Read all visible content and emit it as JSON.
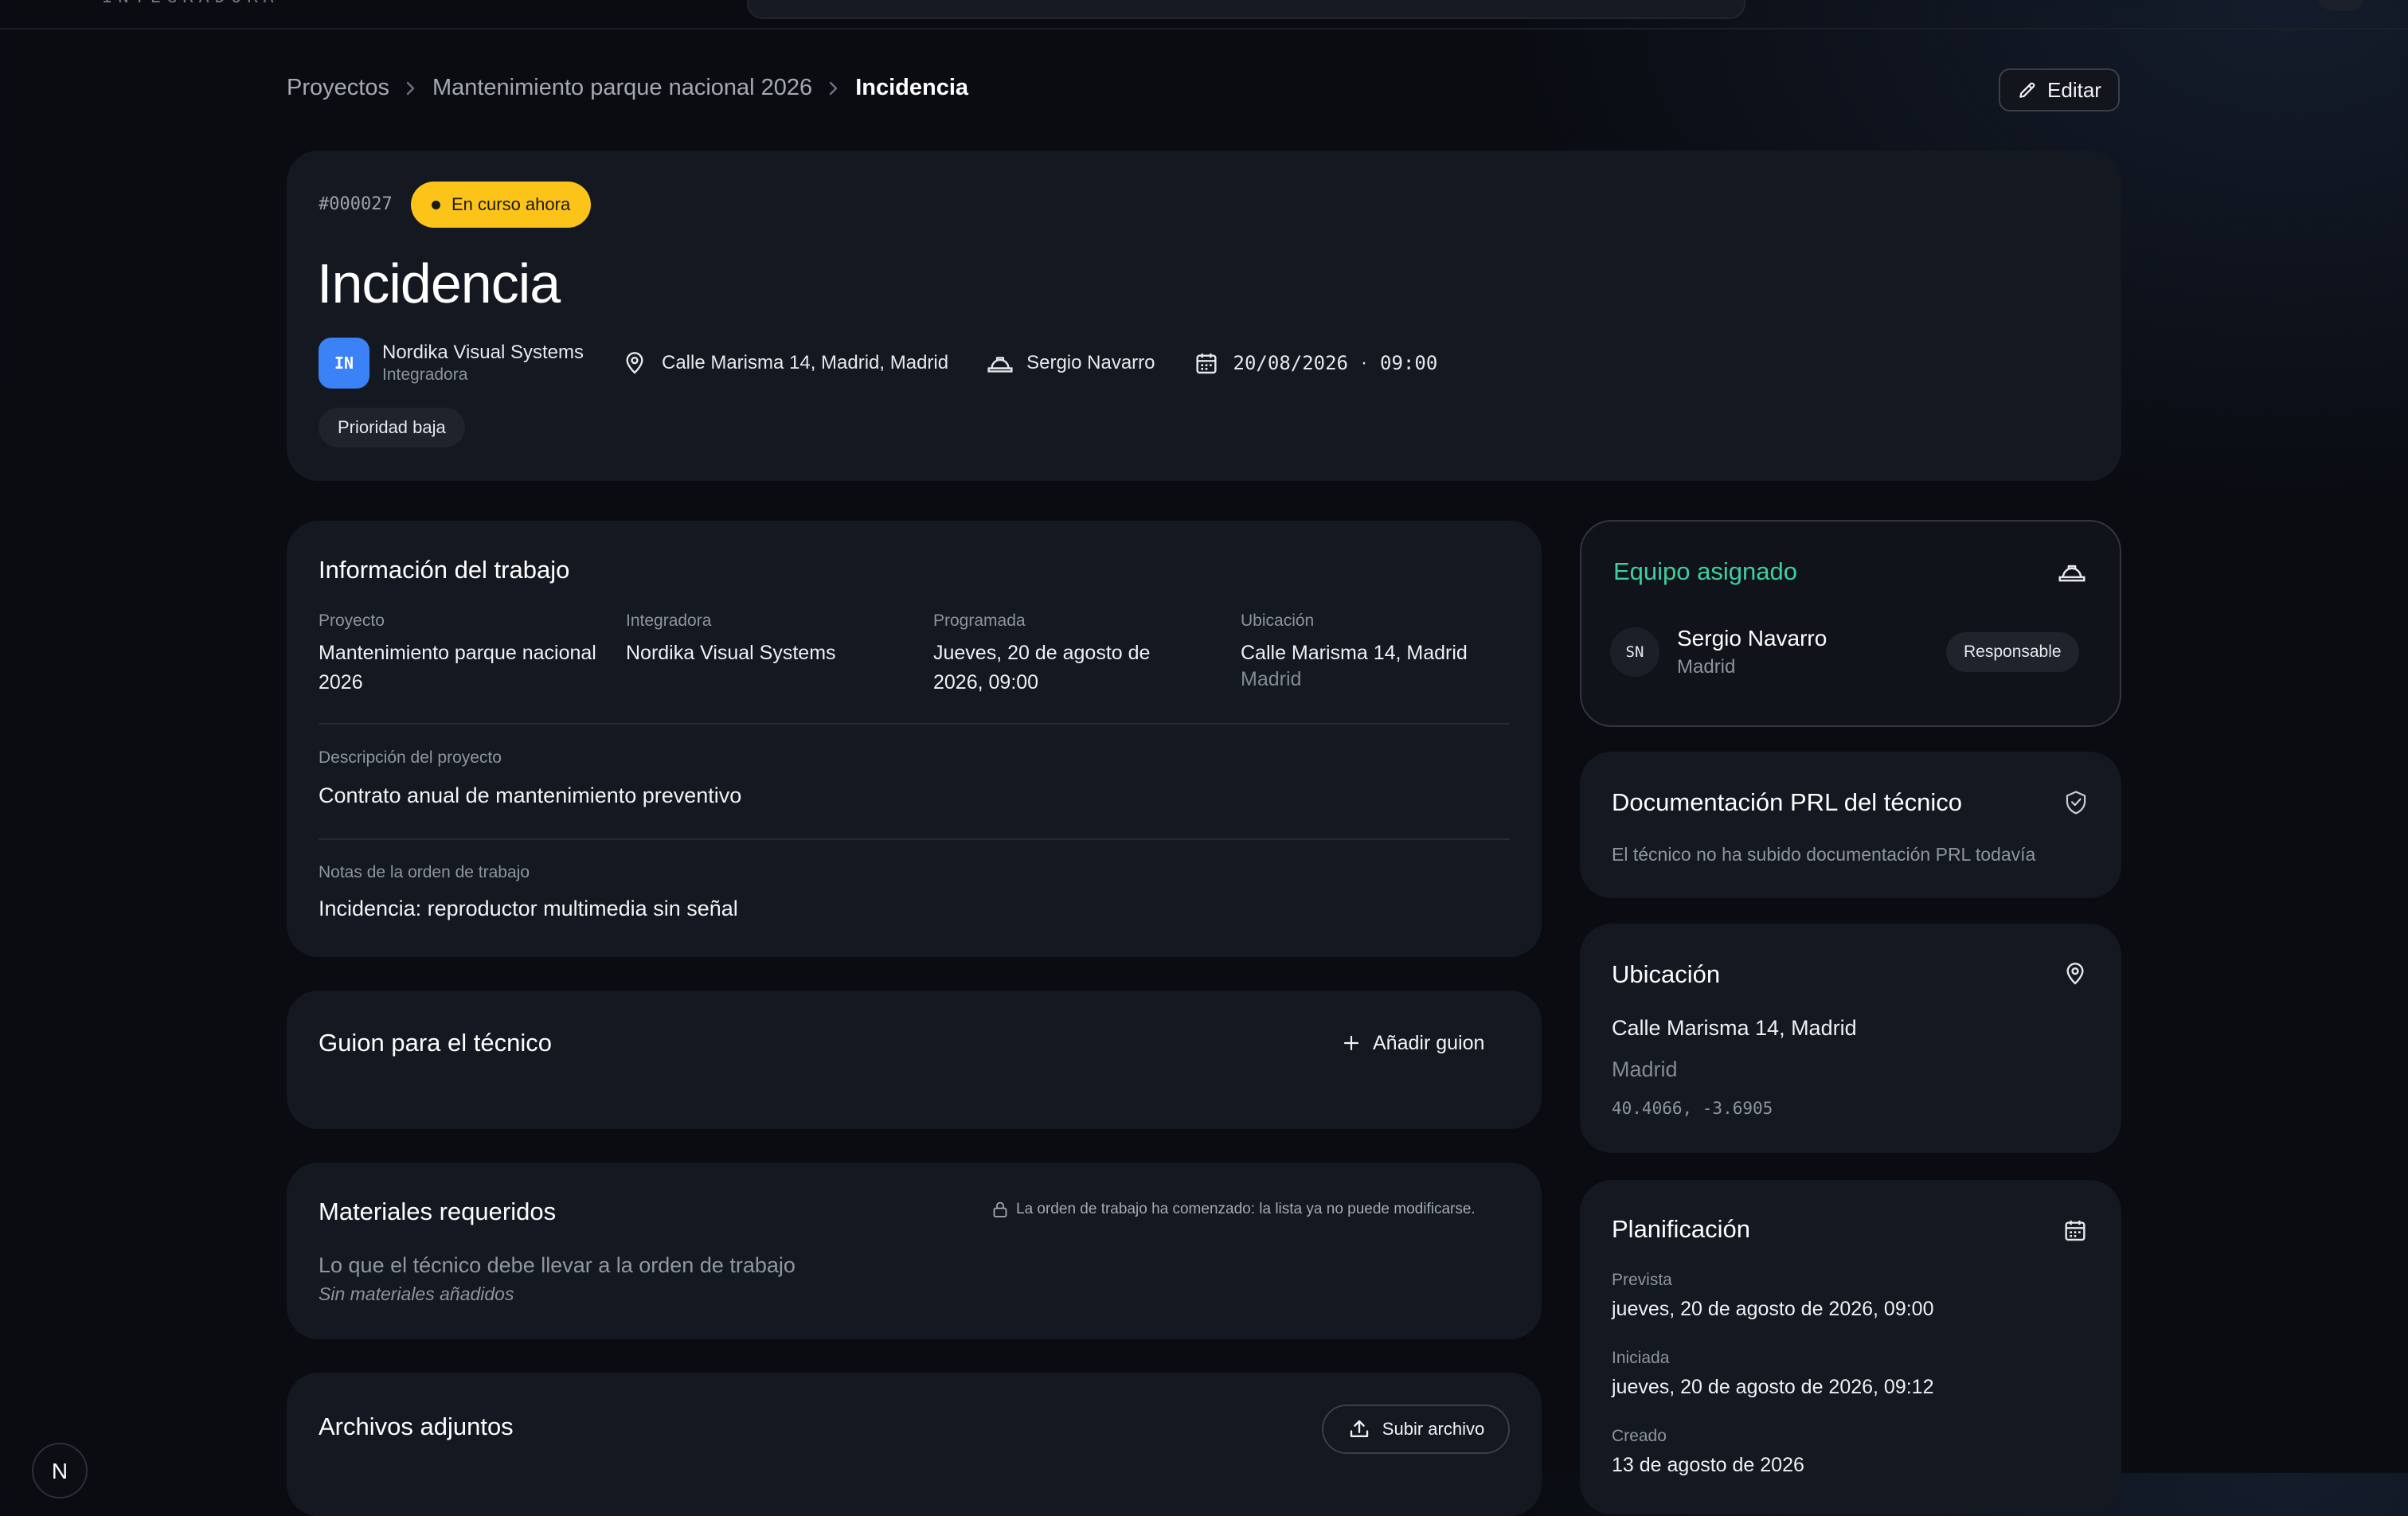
{
  "topbar": {
    "logo_text": "INTEGRADORA"
  },
  "breadcrumb": {
    "items": [
      "Proyectos",
      "Mantenimiento parque nacional 2026",
      "Incidencia"
    ],
    "separator": "›"
  },
  "header": {
    "edit_label": "Editar",
    "id": "#000027",
    "status": "En curso ahora",
    "title": "Incidencia",
    "company_initials": "IN",
    "company_name": "Nordika Visual Systems",
    "company_role": "Integradora",
    "address": "Calle Marisma 14, Madrid, Madrid",
    "technician": "Sergio Navarro",
    "date": "20/08/2026",
    "dot": "·",
    "time": "09:00",
    "priority": "Prioridad baja"
  },
  "info": {
    "title": "Información del trabajo",
    "fields": [
      {
        "label": "Proyecto",
        "value": "Mantenimiento parque nacional 2026"
      },
      {
        "label": "Integradora",
        "value": "Nordika Visual Systems"
      },
      {
        "label": "Programada",
        "value": "Jueves, 20 de agosto de 2026, 09:00"
      },
      {
        "label": "Ubicación",
        "value": "Calle Marisma 14, Madrid",
        "sub": "Madrid"
      }
    ],
    "description_label": "Descripción del proyecto",
    "description": "Contrato anual de mantenimiento preventivo",
    "notes_label": "Notas de la orden de trabajo",
    "notes": "Incidencia: reproductor multimedia sin señal"
  },
  "script": {
    "title": "Guion para el técnico",
    "add_label": "Añadir guion"
  },
  "materials": {
    "title": "Materiales requeridos",
    "locked_note": "La orden de trabajo ha comenzado: la lista ya no puede modificarse.",
    "subtitle": "Lo que el técnico debe llevar a la orden de trabajo",
    "empty": "Sin materiales añadidos"
  },
  "attachments": {
    "title": "Archivos adjuntos",
    "upload_label": "Subir archivo"
  },
  "team": {
    "title": "Equipo asignado",
    "member_initials": "SN",
    "member_name": "Sergio Navarro",
    "member_city": "Madrid",
    "member_role": "Responsable"
  },
  "prl": {
    "title": "Documentación PRL del técnico",
    "empty": "El técnico no ha subido documentación PRL todavía"
  },
  "location": {
    "title": "Ubicación",
    "street": "Calle Marisma 14, Madrid",
    "city": "Madrid",
    "coords": "40.4066, -3.6905"
  },
  "planning": {
    "title": "Planificación",
    "rows": [
      {
        "label": "Prevista",
        "value": "jueves, 20 de agosto de 2026, 09:00"
      },
      {
        "label": "Iniciada",
        "value": "jueves, 20 de agosto de 2026, 09:12"
      },
      {
        "label": "Creado",
        "value": "13 de agosto de 2026"
      }
    ]
  },
  "floating_badge": {
    "letter": "N"
  },
  "colors": {
    "background": "#0a0c12",
    "card": "#141820",
    "status_yellow": "#fcc419",
    "accent_teal": "#3ecf9e",
    "avatar_blue": "#3b82f6"
  }
}
